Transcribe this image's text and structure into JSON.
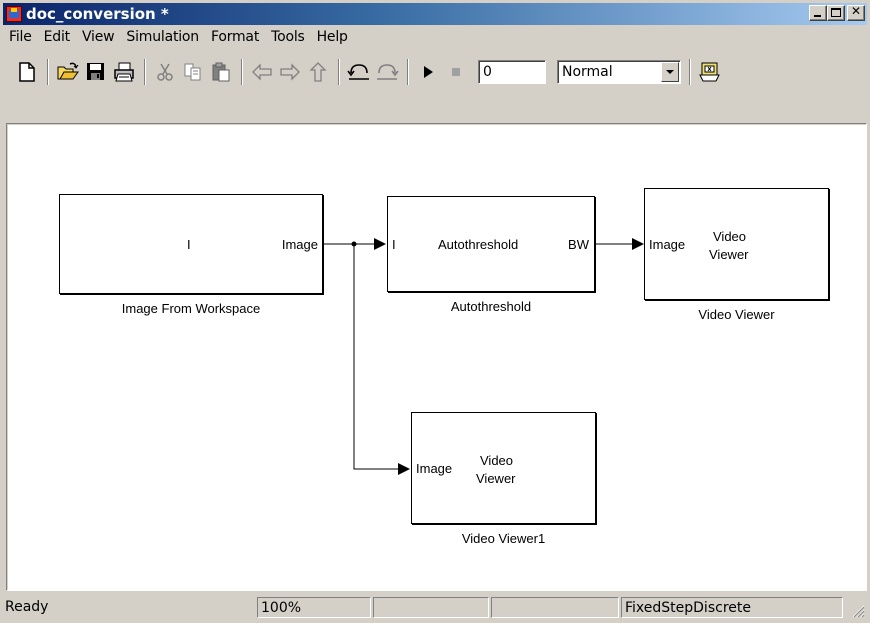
{
  "window": {
    "title": "doc_conversion *",
    "icon": "simulink-model-icon"
  },
  "menu": [
    "File",
    "Edit",
    "View",
    "Simulation",
    "Format",
    "Tools",
    "Help"
  ],
  "toolbar": {
    "buttons": [
      "new-model-icon",
      "open-icon",
      "save-icon",
      "print-icon",
      "cut-icon",
      "copy-icon",
      "paste-icon",
      "back-icon",
      "forward-icon",
      "up-icon",
      "undo-icon",
      "redo-icon",
      "start-simulation-icon",
      "stop-simulation-icon",
      "library-browser-icon"
    ],
    "stop_time": "0",
    "sim_mode": "Normal"
  },
  "diagram": {
    "blocks": {
      "image_from_workspace": {
        "port_in": "I",
        "port_out": "Image",
        "caption": "Image From Workspace"
      },
      "autothreshold": {
        "port_in": "I",
        "center": "Autothreshold",
        "port_out": "BW",
        "caption": "Autothreshold"
      },
      "video_viewer": {
        "port_in": "Image",
        "center_line1": "Video",
        "center_line2": "Viewer",
        "caption": "Video Viewer"
      },
      "video_viewer1": {
        "port_in": "Image",
        "center_line1": "Video",
        "center_line2": "Viewer",
        "caption": "Video Viewer1"
      }
    }
  },
  "status": {
    "state": "Ready",
    "zoom": "100%",
    "cell3": "",
    "cell4": "",
    "solver": "FixedStepDiscrete"
  }
}
